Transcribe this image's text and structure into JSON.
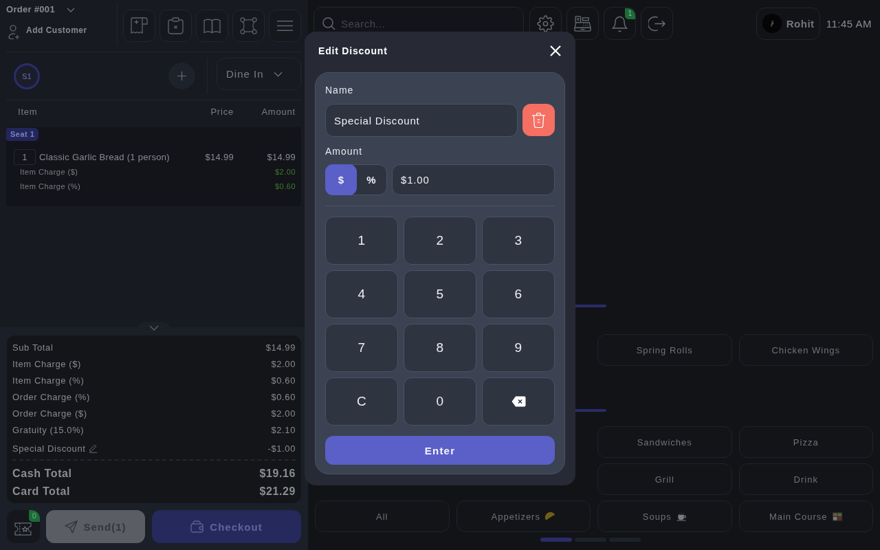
{
  "top_bar": {
    "search": {
      "placeholder": "Search..."
    },
    "notification_count": "1",
    "user_name": "Rohit",
    "time": "11:45 AM"
  },
  "order_panel": {
    "order_title": "Order #001",
    "add_customer": "Add Customer",
    "seats": [
      {
        "label": "S1",
        "selected": true
      }
    ],
    "order_type": "Dine In",
    "columns": [
      "Item",
      "Price",
      "Amount"
    ],
    "seat_groups": [
      {
        "seat": "Seat 1",
        "items": [
          {
            "qty": "1",
            "name": "Classic Garlic Bread (1 person)",
            "price": "$14.99",
            "amount": "$14.99",
            "charges": [
              {
                "label": "Item Charge ($)",
                "amount": "$2.00"
              },
              {
                "label": "Item Charge (%)",
                "amount": "$0.60"
              }
            ]
          }
        ]
      }
    ]
  },
  "summary": {
    "lines": [
      {
        "label": "Sub Total",
        "value": "$14.99",
        "editable": false
      },
      {
        "label": "Item Charge ($)",
        "value": "$2.00",
        "editable": false
      },
      {
        "label": "Item Charge (%)",
        "value": "$0.60",
        "editable": false
      },
      {
        "label": "Order Charge (%)",
        "value": "$0.60",
        "editable": false
      },
      {
        "label": "Order Charge ($)",
        "value": "$2.00",
        "editable": false
      },
      {
        "label": "Gratuity (15.0%)",
        "value": "$2.10",
        "editable": false
      },
      {
        "label": "Special Discount",
        "value": "-$1.00",
        "editable": true
      }
    ],
    "totals": [
      {
        "label": "Cash Total",
        "value": "$19.16"
      },
      {
        "label": "Card Total",
        "value": "$21.29"
      }
    ]
  },
  "actions": {
    "loyalty_count": "0",
    "send": "Send(1)",
    "checkout": "Checkout"
  },
  "menu": {
    "items": [
      {
        "label": "Spring Rolls"
      },
      {
        "label": "Chicken Wings"
      }
    ],
    "category_rows": [
      [
        {
          "label": "Sandwiches",
          "kind": "plain"
        },
        {
          "label": "Pizza",
          "kind": "plain"
        }
      ],
      [
        {
          "label": "Grill",
          "kind": "plain"
        },
        {
          "label": "Drink",
          "kind": "plain"
        }
      ],
      [
        {
          "label": "All",
          "kind": "plain"
        },
        {
          "label": "Appetizers",
          "kind": "taco"
        },
        {
          "label": "Soups",
          "kind": "cup"
        },
        {
          "label": "Main Course",
          "kind": "bento"
        }
      ]
    ],
    "pages": [
      {
        "selected": true
      },
      {
        "selected": false
      },
      {
        "selected": false
      }
    ]
  },
  "dialog": {
    "title": "Edit Discount",
    "name_label": "Name",
    "name_value": "Special Discount",
    "amount_label": "Amount",
    "amount_types": [
      {
        "label": "$",
        "selected": true
      },
      {
        "label": "%",
        "selected": false
      }
    ],
    "amount_value": "$1.00",
    "keypad": [
      {
        "kind": "digit",
        "label": "1"
      },
      {
        "kind": "digit",
        "label": "2"
      },
      {
        "kind": "digit",
        "label": "3"
      },
      {
        "kind": "digit",
        "label": "4"
      },
      {
        "kind": "digit",
        "label": "5"
      },
      {
        "kind": "digit",
        "label": "6"
      },
      {
        "kind": "digit",
        "label": "7"
      },
      {
        "kind": "digit",
        "label": "8"
      },
      {
        "kind": "digit",
        "label": "9"
      },
      {
        "kind": "clear",
        "label": "C"
      },
      {
        "kind": "digit",
        "label": "0"
      },
      {
        "kind": "backspace"
      }
    ],
    "enter": "Enter"
  }
}
